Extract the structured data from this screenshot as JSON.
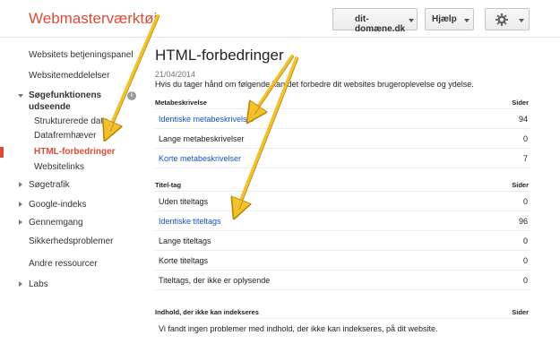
{
  "header": {
    "app_title": "Webmasterværktøj",
    "domain": "dit-domæne.dk",
    "help": "Hjælp",
    "settings_icon": "gear-icon"
  },
  "sidebar": {
    "dashboard": "Websitets betjeningspanel",
    "messages": "Websitemeddelelser",
    "search_appearance": "Søgefunktionens udseende",
    "structured_data": "Strukturerede data",
    "data_highlighter": "Datafremhæver",
    "html_improvements": "HTML-forbedringer",
    "sitelinks": "Websitelinks",
    "search_traffic": "Søgetrafik",
    "google_index": "Google-indeks",
    "crawl": "Gennemgang",
    "security_issues": "Sikkerhedsproblemer",
    "other_resources": "Andre ressourcer",
    "labs": "Labs"
  },
  "main": {
    "title": "HTML-forbedringer",
    "date": "21/04/2014",
    "description": "Hvis du tager hånd om følgende kan det forbedre dit websites brugeroplevelse og ydelse.",
    "pages_header": "Sider",
    "meta": {
      "heading": "Metabeskrivelse",
      "rows": [
        {
          "label": "Identiske metabeskrivelser",
          "value": "94"
        },
        {
          "label": "Lange metabeskrivelser",
          "value": "0"
        },
        {
          "label": "Korte metabeskrivelser",
          "value": "7"
        }
      ]
    },
    "title_tag": {
      "heading": "Titel-tag",
      "rows": [
        {
          "label": "Uden titeltags",
          "value": "0"
        },
        {
          "label": "Identiske titeltags",
          "value": "96"
        },
        {
          "label": "Lange titeltags",
          "value": "0"
        },
        {
          "label": "Korte titeltags",
          "value": "0"
        },
        {
          "label": "Titeltags, der ikke er oplysende",
          "value": "0"
        }
      ]
    },
    "non_indexable": {
      "heading": "Indhold, der ikke kan indekseres",
      "message": "Vi fandt ingen problemer med indhold, der ikke kan indekseres, på dit website."
    }
  },
  "colors": {
    "brand": "#dd4b39",
    "link": "#1155cc",
    "arrow": "#f3c12b"
  }
}
